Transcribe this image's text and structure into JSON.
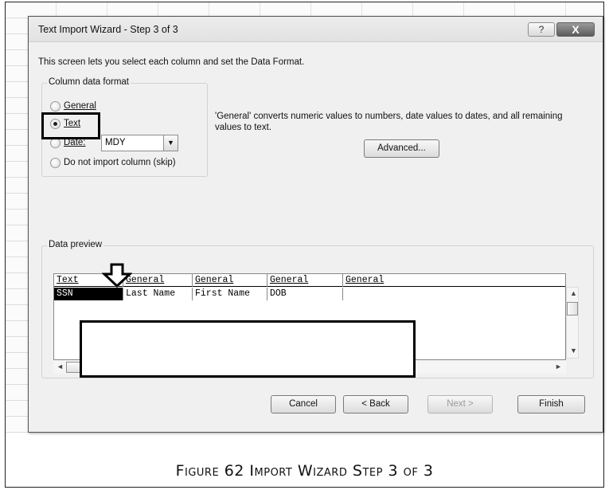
{
  "dialog": {
    "title": "Text Import Wizard - Step 3 of 3",
    "help_icon": "?",
    "close_icon": "X",
    "intro": "This screen lets you select each column and set the Data Format."
  },
  "column_format": {
    "legend": "Column data format",
    "options": [
      {
        "label": "General",
        "selected": false
      },
      {
        "label": "Text",
        "selected": true
      },
      {
        "label": "Date:",
        "selected": false
      },
      {
        "label": "Do not import column (skip)",
        "selected": false
      }
    ],
    "date_value": "MDY",
    "dropdown_arrow": "▼"
  },
  "description": "'General' converts numeric values to numbers, date values to dates, and all remaining values to text.",
  "advanced_label": "Advanced...",
  "preview": {
    "legend": "Data preview",
    "headers": [
      "Text",
      "General",
      "General",
      "General",
      "General"
    ],
    "row": [
      "SSN",
      "Last Name",
      "First Name",
      "DOB",
      ""
    ]
  },
  "scroll_arrows": {
    "up": "▲",
    "down": "▼",
    "left": "◄",
    "right": "►"
  },
  "buttons": {
    "cancel": "Cancel",
    "back": "< Back",
    "next": "Next >",
    "finish": "Finish"
  },
  "caption": "Figure 62 Import Wizard Step 3 of 3",
  "colors": {
    "accent_border": "#000000",
    "dialog_bg": "#f0f0f0"
  },
  "icons": [
    "help-icon",
    "close-icon",
    "dropdown-arrow-icon",
    "down-arrow-marker-icon"
  ]
}
